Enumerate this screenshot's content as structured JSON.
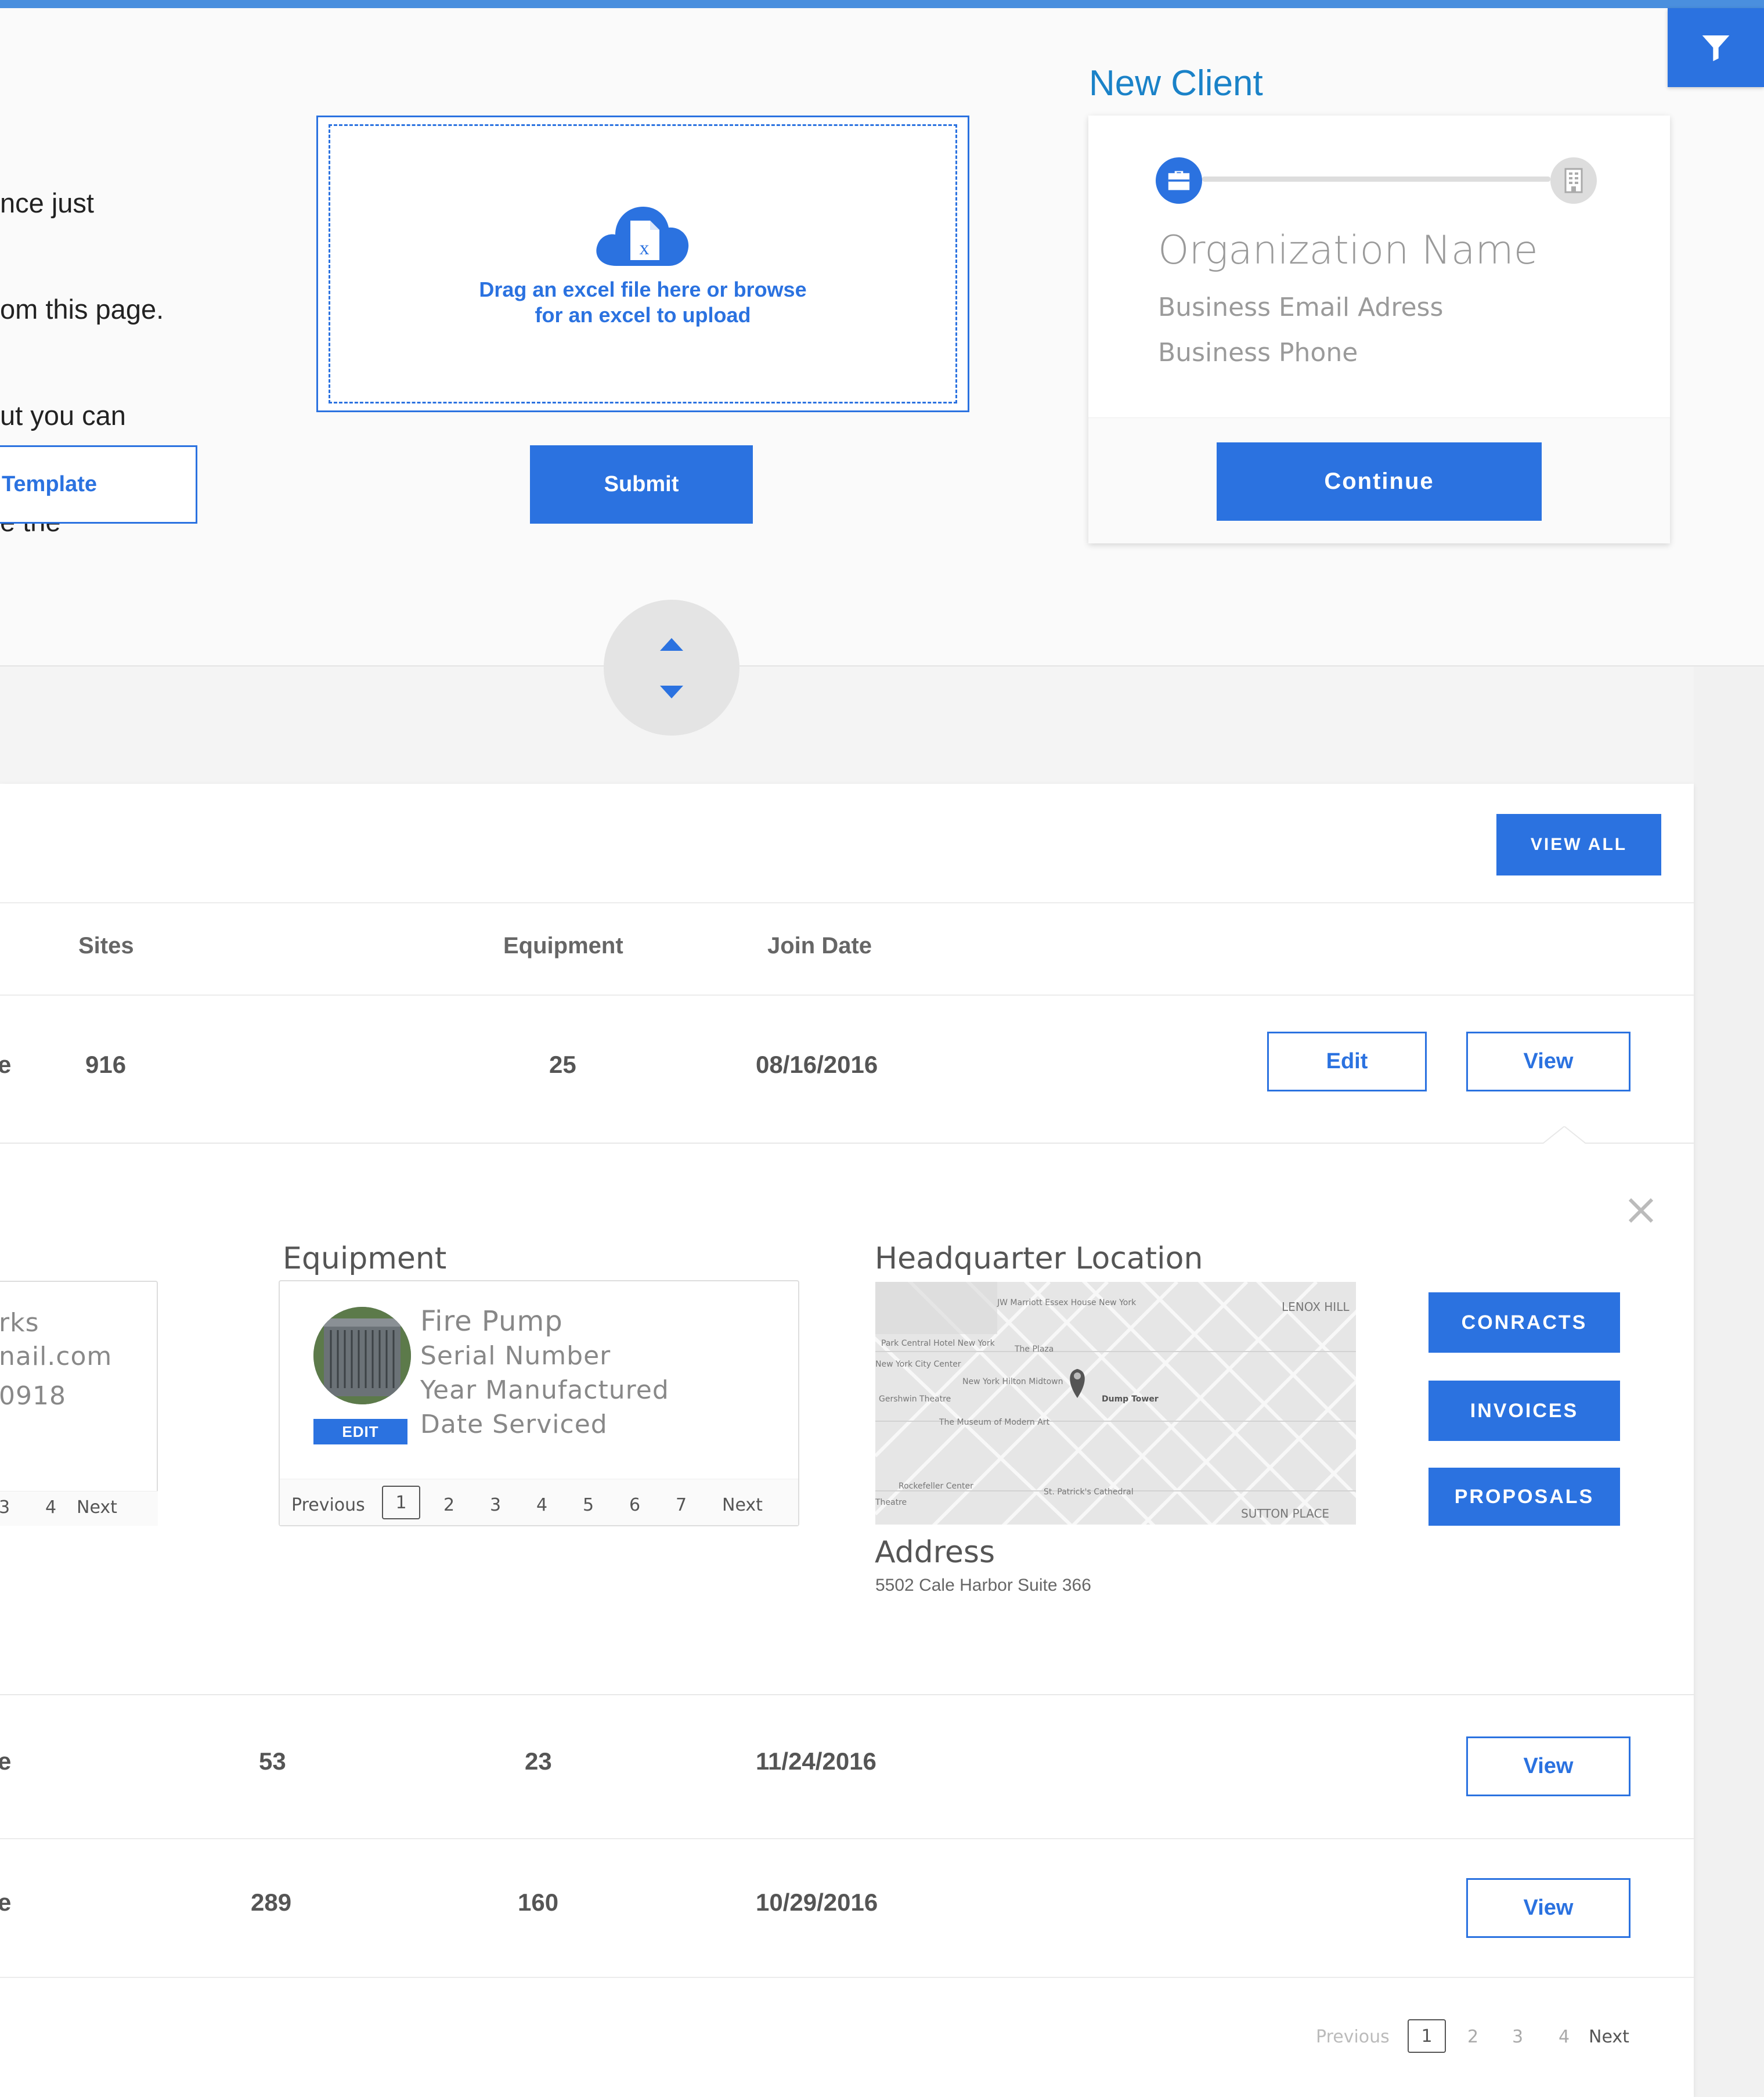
{
  "intro_lines": [
    "nce just",
    "om this page.",
    "ut you can",
    "e the"
  ],
  "template_button": "Template",
  "dropzone": {
    "line1": "Drag an excel file here or browse",
    "line2": "for an excel to upload",
    "icon": "cloud-excel-upload-icon"
  },
  "submit_label": "Submit",
  "new_client": {
    "title": "New Client",
    "org_placeholder": "Organization Name",
    "email_placeholder": "Business Email Adress",
    "phone_placeholder": "Business Phone",
    "continue_label": "Continue"
  },
  "table": {
    "view_all_label": "VIEW ALL",
    "headers": {
      "sites": "Sites",
      "equipment": "Equipment",
      "join_date": "Join Date"
    },
    "rows": [
      {
        "name_frag": "e",
        "sites": "916",
        "equipment": "25",
        "join_date": "08/16/2016",
        "edit": "Edit",
        "view": "View"
      },
      {
        "name_frag": "e",
        "sites": "53",
        "equipment": "23",
        "join_date": "11/24/2016",
        "view": "View"
      },
      {
        "name_frag": "e",
        "sites": "289",
        "equipment": "160",
        "join_date": "10/29/2016",
        "view": "View"
      }
    ]
  },
  "detail": {
    "contact_lines": [
      "rks",
      "nail.com",
      "0918"
    ],
    "contact_pager": {
      "p3": "3",
      "p4": "4",
      "next": "Next"
    },
    "equipment_title": "Equipment",
    "equipment": {
      "name": "Fire Pump",
      "serial": "Serial Number",
      "year": "Year Manufactured",
      "serviced": "Date Serviced",
      "edit_label": "EDIT"
    },
    "equipment_pager": {
      "previous": "Previous",
      "pages": [
        "1",
        "2",
        "3",
        "4",
        "5",
        "6",
        "7"
      ],
      "next": "Next"
    },
    "hq_title": "Headquarter Location",
    "map_labels": [
      "JW Marriott Essex House New York",
      "LENOX HILL",
      "Park Central Hotel New York",
      "The Plaza",
      "New York City Center",
      "New York Hilton Midtown",
      "Dump Tower",
      "Gershwin Theatre",
      "The Museum of Modern Art",
      "Rockefeller Center",
      "St. Patrick's Cathedral",
      "SUTTON PLACE",
      "Theatre"
    ],
    "address_title": "Address",
    "address_value": "5502 Cale Harbor Suite 366",
    "buttons": [
      "CONRACTS",
      "INVOICES",
      "PROPOSALS"
    ]
  },
  "bottom_pager": {
    "previous": "Previous",
    "pages": [
      "1",
      "2",
      "3",
      "4"
    ],
    "next": "Next"
  },
  "colors": {
    "accent": "#2b72e0",
    "title_blue": "#1a82c8",
    "topbar": "#4a8fde"
  }
}
